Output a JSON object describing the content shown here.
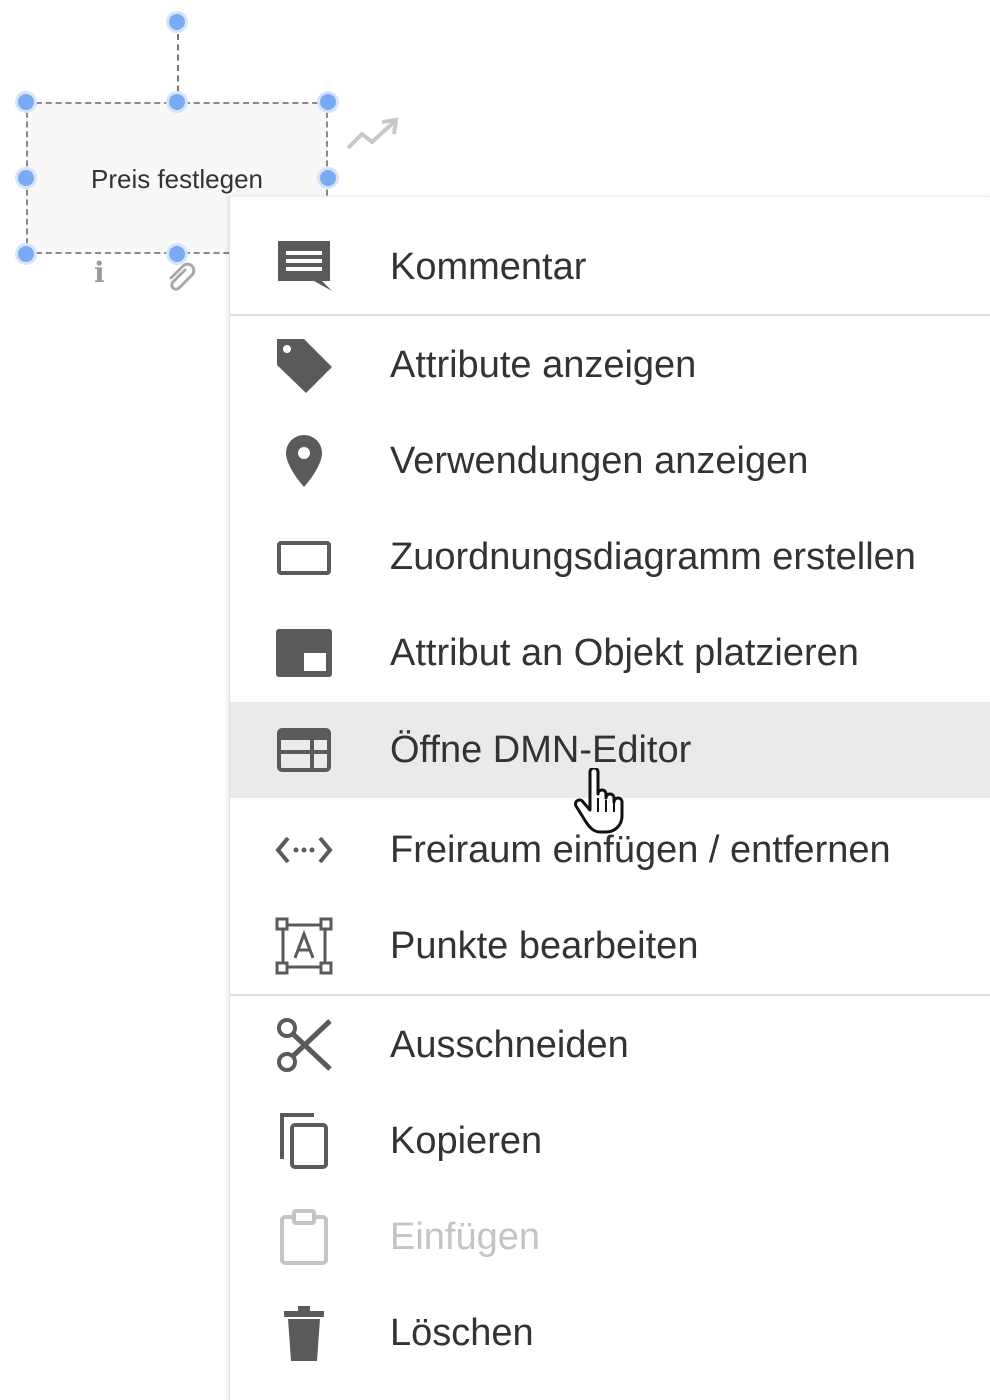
{
  "shape": {
    "label": "Preis festlegen"
  },
  "icons": {
    "link": "trending-up-icon",
    "info": "info-icon",
    "attach": "attachment-icon",
    "cursor": "hand-pointer-icon"
  },
  "colors": {
    "handle": "#7aaaf2",
    "icon": "#5a5a5a",
    "icon_disabled": "#c4c4c4",
    "text": "#333333",
    "hover_bg": "#eaeaea"
  },
  "menu": {
    "items": [
      {
        "label": "Kommentar",
        "icon": "comment-icon"
      },
      {
        "label": "Attribute anzeigen",
        "icon": "tag-icon"
      },
      {
        "label": "Verwendungen anzeigen",
        "icon": "location-pin-icon"
      },
      {
        "label": "Zuordnungsdiagramm erstellen",
        "icon": "rectangle-icon"
      },
      {
        "label": "Attribut an Objekt platzieren",
        "icon": "picture-in-picture-icon"
      },
      {
        "label": "Öffne DMN-Editor",
        "icon": "table-icon",
        "state": "hovered"
      },
      {
        "label": "Freiraum einfügen / entfernen",
        "icon": "space-arrows-icon"
      },
      {
        "label": "Punkte bearbeiten",
        "icon": "text-frame-icon"
      },
      {
        "label": "Ausschneiden",
        "icon": "scissors-icon"
      },
      {
        "label": "Kopieren",
        "icon": "copy-icon"
      },
      {
        "label": "Einfügen",
        "icon": "clipboard-icon",
        "state": "disabled"
      },
      {
        "label": "Löschen",
        "icon": "trash-icon"
      }
    ]
  }
}
